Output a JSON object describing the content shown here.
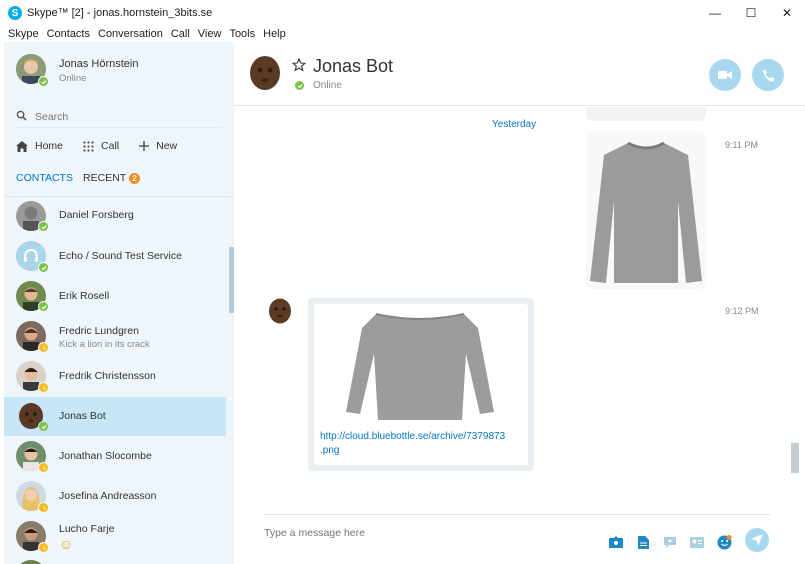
{
  "window": {
    "title": "Skype™ [2] - jonas.hornstein_3bits.se",
    "logo_letter": "S",
    "minimize": "—",
    "maximize": "☐",
    "close": "✕"
  },
  "menu": [
    "Skype",
    "Contacts",
    "Conversation",
    "Call",
    "View",
    "Tools",
    "Help"
  ],
  "profile": {
    "name": "Jonas Hörnstein",
    "status": "Online"
  },
  "search": {
    "placeholder": "Search"
  },
  "nav": {
    "home": "Home",
    "call": "Call",
    "new": "New"
  },
  "tabs": {
    "contacts": "CONTACTS",
    "recent": "RECENT",
    "recent_badge": "2"
  },
  "contacts": [
    {
      "name": "Daniel Forsberg",
      "sub": "",
      "status": "online"
    },
    {
      "name": "Echo / Sound Test Service",
      "sub": "",
      "status": "online"
    },
    {
      "name": "Erik Rosell",
      "sub": "",
      "status": "online"
    },
    {
      "name": "Fredric Lundgren",
      "sub": "Kick a lion in its crack",
      "status": "away"
    },
    {
      "name": "Fredrik Christensson",
      "sub": "",
      "status": "away"
    },
    {
      "name": "Jonas Bot",
      "sub": "",
      "status": "online"
    },
    {
      "name": "Jonathan Slocombe",
      "sub": "",
      "status": "away"
    },
    {
      "name": "Josefina Andreasson",
      "sub": "",
      "status": "away"
    },
    {
      "name": "Lucho Farje",
      "sub": "☺",
      "status": "away"
    }
  ],
  "chat": {
    "name": "Jonas Bot",
    "status": "Online",
    "day_separator": "Yesterday",
    "time1": "9:11 PM",
    "time2": "9:12 PM",
    "link_line1": "http://cloud.bluebottle.se/archive/7379873",
    "link_line2": ".png"
  },
  "compose": {
    "placeholder": "Type a message here"
  },
  "colors": {
    "accent": "#00aff0",
    "link": "#0078c8",
    "online": "#7dc242",
    "away": "#fdb913"
  }
}
